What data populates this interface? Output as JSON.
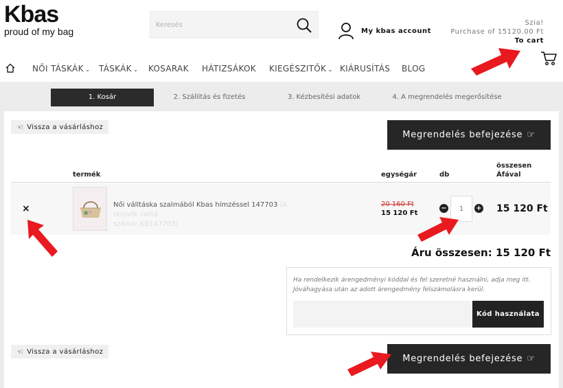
{
  "logo": {
    "mark": "Kbas",
    "tagline": "proud of my bag"
  },
  "search": {
    "placeholder": "Keresés"
  },
  "account": {
    "label": "My kbas account"
  },
  "cart": {
    "greeting": "Szia!",
    "purchase": "Purchase of 15120.00 Ft",
    "to_cart": "To cart"
  },
  "nav": {
    "items": [
      {
        "label": "NŐI TÁSKÁK",
        "chevron": "⌄"
      },
      {
        "label": "TÁSKÁK",
        "chevron": "⌄"
      },
      {
        "label": "KOSARAK",
        "chevron": ""
      },
      {
        "label": "HÁTIZSÁKOK",
        "chevron": ""
      },
      {
        "label": "KIEGÉSZITŐK",
        "chevron": "⌄"
      },
      {
        "label": "KIÁRUSÍTÁS",
        "chevron": ""
      },
      {
        "label": "BLOG",
        "chevron": ""
      }
    ]
  },
  "steps": [
    {
      "label": "1. Kosár"
    },
    {
      "label": "2. Szállítás és fizetés"
    },
    {
      "label": "3. Kézbesítési adatok"
    },
    {
      "label": "4. A megrendelés megerősítése"
    }
  ],
  "back_label": "Vissza a vásárláshoz",
  "finish_label": "Megrendelés befejezése",
  "table": {
    "headers": {
      "product": "termék",
      "unit_price": "egységár",
      "qty": "db",
      "total_line1": "összesen",
      "total_line2": "Áfával"
    }
  },
  "item": {
    "name": "Női válltáska szalmából Kbas hímzéssel 147703",
    "stock": "(A termék raktá",
    "sku": "száma: KB147703)",
    "old_price": "20 160 Ft",
    "price": "15 120 Ft",
    "qty": "1",
    "total": "15 120 Ft",
    "remove": "×"
  },
  "grand_total": "Áru összesen: 15 120 Ft",
  "coupon": {
    "text": "Ha rendelkezik árengedményi kóddal és fel szeretné használni, adja meg itt. Jóváhagyása után az adott árengedmény felszámolásra kerül.",
    "button": "Kód használata"
  },
  "colors": {
    "arrow": "#e8191f",
    "dark": "#262626",
    "old_price": "#d0312d"
  }
}
